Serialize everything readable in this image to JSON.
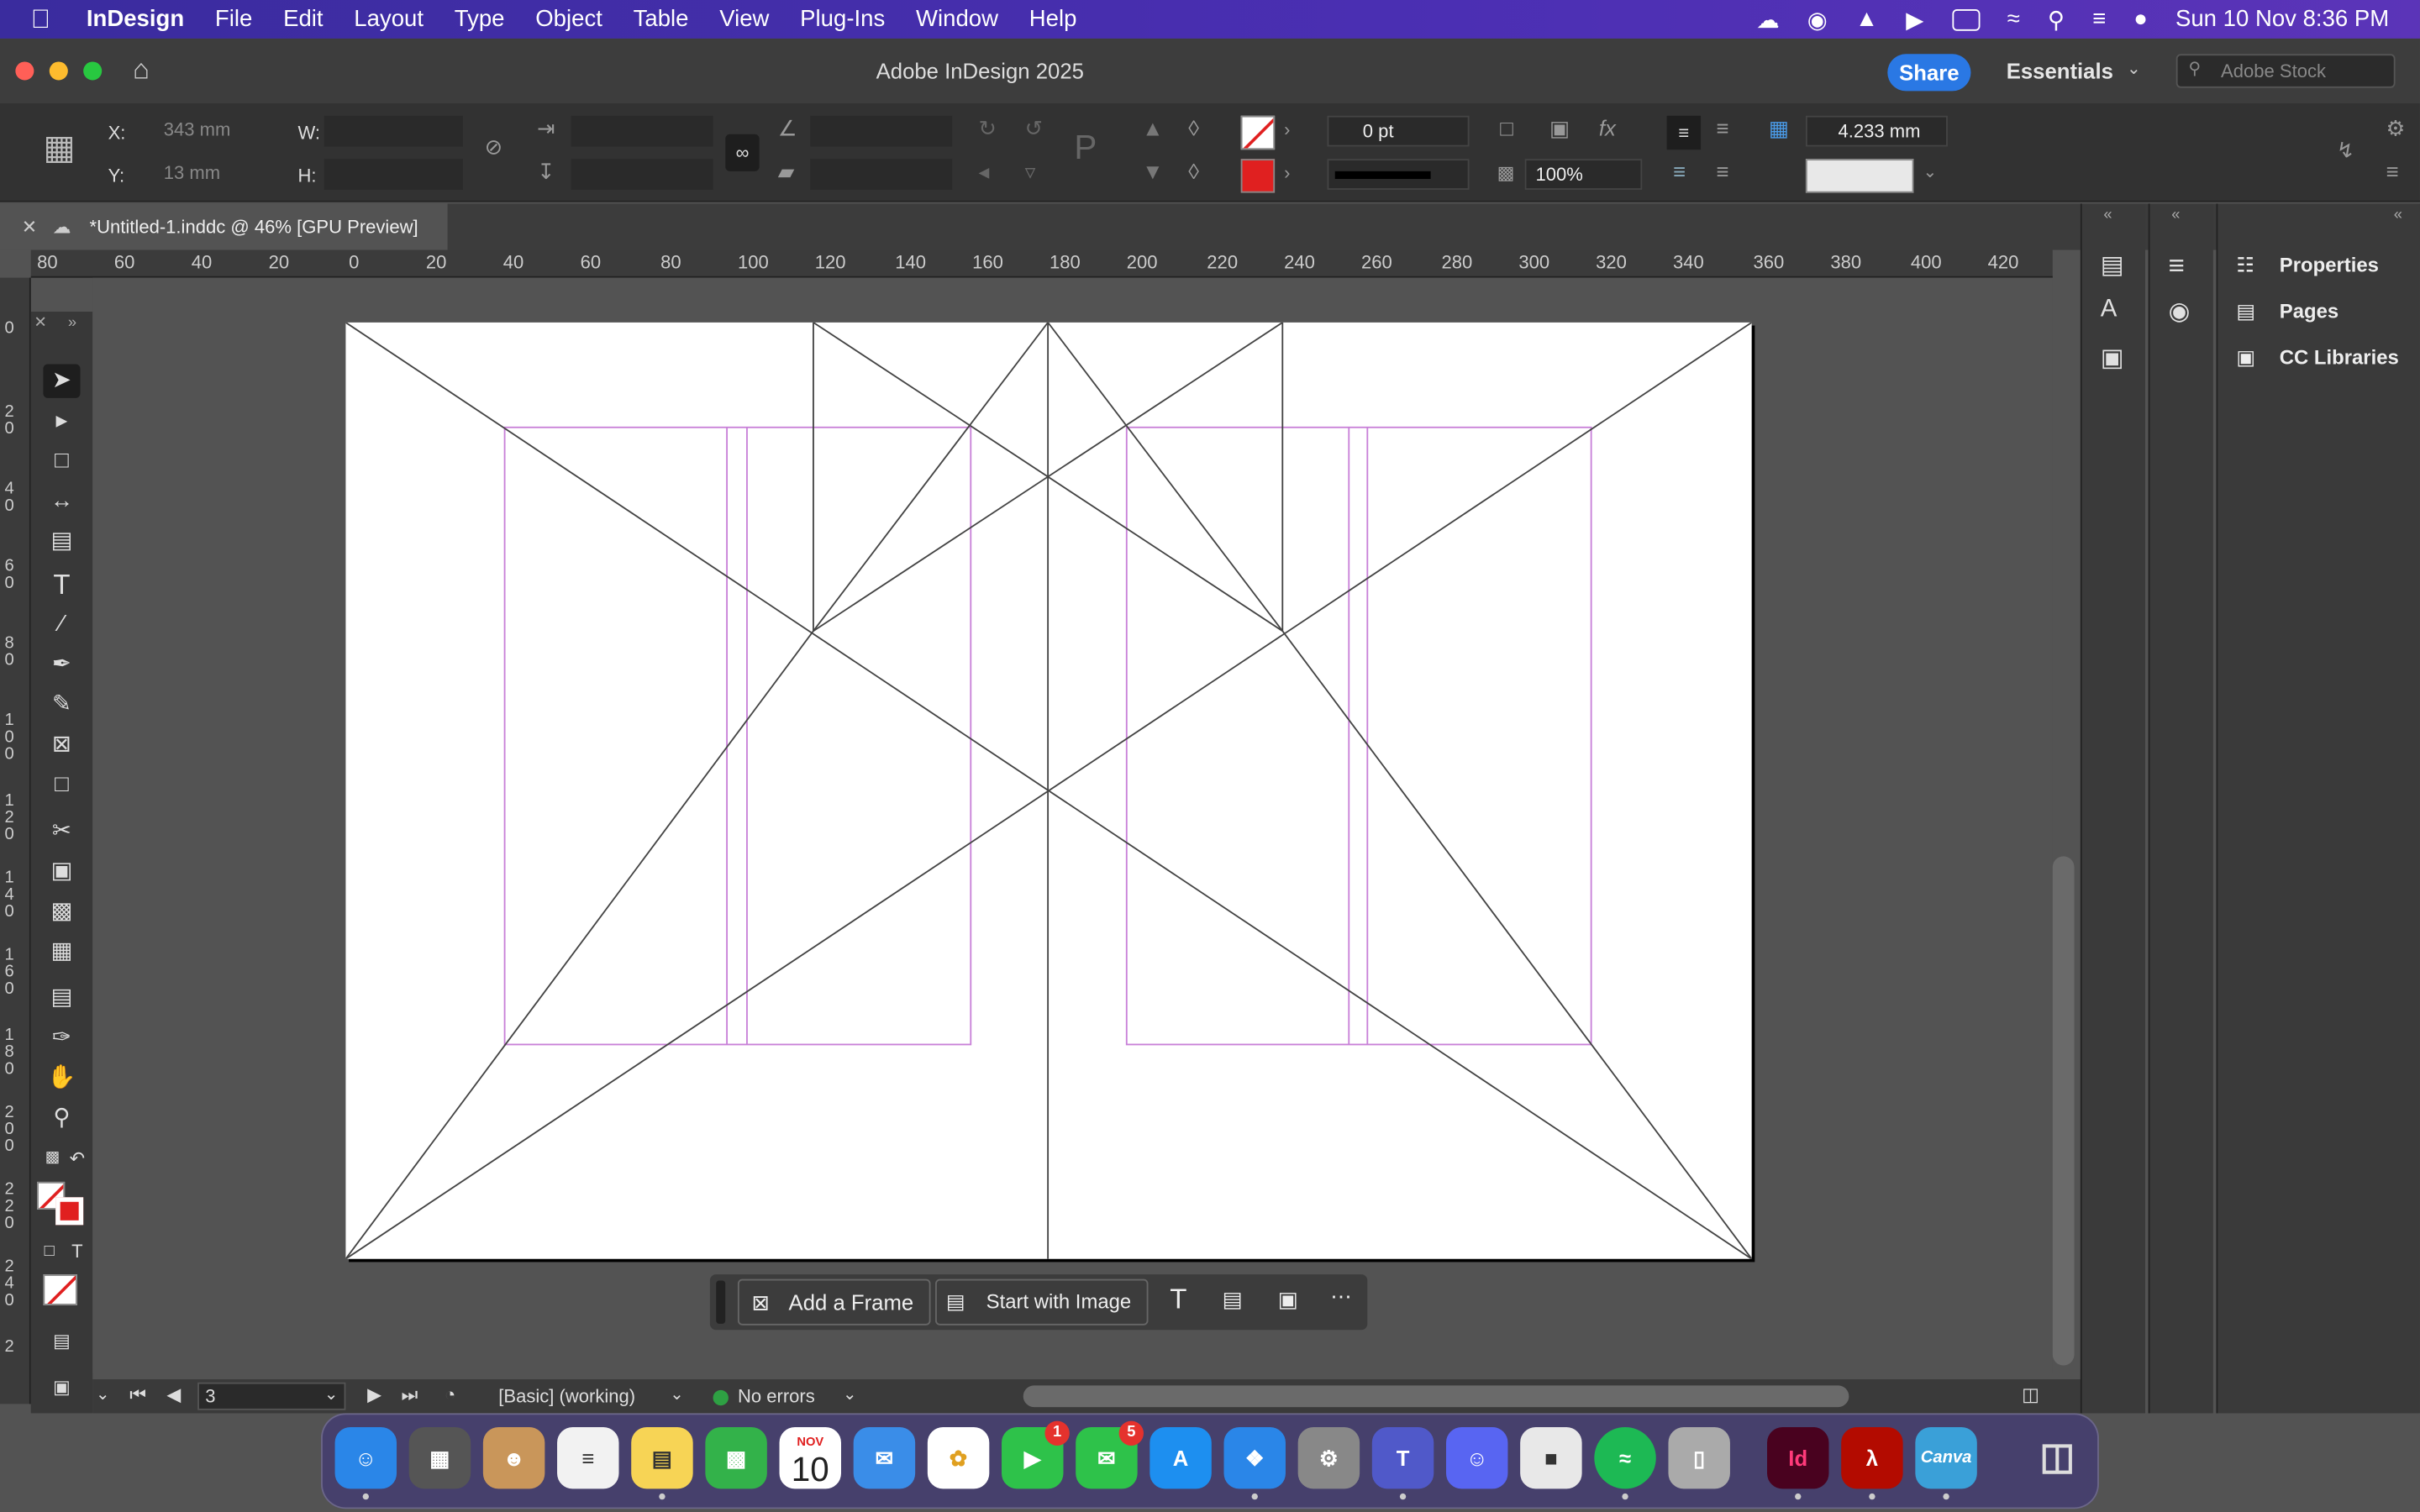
{
  "menubar": {
    "app": "InDesign",
    "items": [
      "File",
      "Edit",
      "Layout",
      "Type",
      "Object",
      "Table",
      "View",
      "Plug-Ins",
      "Window",
      "Help"
    ],
    "datetime": "Sun 10 Nov  8:36 PM"
  },
  "title": "Adobe InDesign 2025",
  "share": "Share",
  "workspace": "Essentials",
  "stock_placeholder": "Adobe Stock",
  "control": {
    "x_label": "X:",
    "x_value": "343 mm",
    "y_label": "Y:",
    "y_value": "13 mm",
    "w_label": "W:",
    "h_label": "H:",
    "stroke_weight": "0 pt",
    "opacity": "100%",
    "gap": "4.233 mm"
  },
  "doc_tab": "*Untitled-1.inddc @ 46% [GPU Preview]",
  "ruler_h": [
    "80",
    "60",
    "40",
    "20",
    "0",
    "20",
    "40",
    "60",
    "80",
    "100",
    "120",
    "140",
    "160",
    "180",
    "200",
    "220",
    "240",
    "260",
    "280",
    "300",
    "320",
    "340",
    "360",
    "380",
    "400",
    "420"
  ],
  "ruler_v": [
    "0",
    "2\n0",
    "4\n0",
    "6\n0",
    "8\n0",
    "1\n0\n0",
    "1\n2\n0",
    "1\n4\n0",
    "1\n6\n0",
    "1\n8\n0",
    "2\n0\n0",
    "2\n2\n0",
    "2\n4\n0",
    "2"
  ],
  "taskbar": {
    "add_frame": "Add a Frame",
    "start_image": "Start with Image"
  },
  "status": {
    "page": "3",
    "style": "[Basic] (working)",
    "errors": "No errors"
  },
  "panels": [
    "Properties",
    "Pages",
    "CC Libraries"
  ],
  "dock": {
    "calendar_month": "NOV",
    "calendar_day": "10",
    "facetime_badge": "1",
    "messages_badge": "5",
    "indesign": "Id",
    "canva": "Canva"
  }
}
